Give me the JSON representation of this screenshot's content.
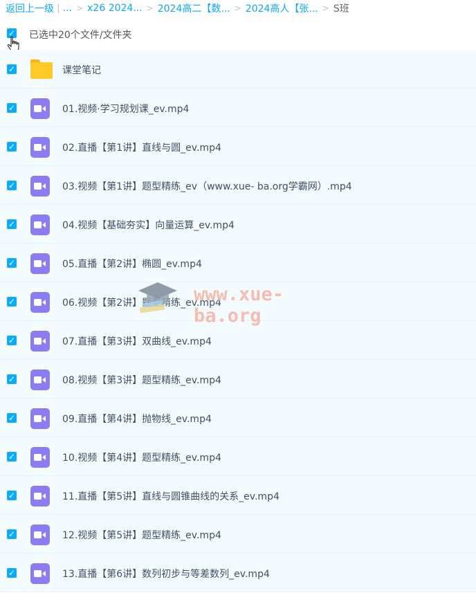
{
  "breadcrumb": {
    "back_label": "返回上一级",
    "ellipsis": "...",
    "crumbs": [
      "x26 2024...",
      "2024高二【数...",
      "2024高人【张..."
    ],
    "current": "S班"
  },
  "selection": {
    "summary": "已选中20个文件/文件夹",
    "checked": true
  },
  "files": [
    {
      "type": "folder",
      "name": "课堂笔记"
    },
    {
      "type": "video",
      "name": "01.视频·学习规划课_ev.mp4"
    },
    {
      "type": "video",
      "name": "02.直播【第1讲】直线与圆_ev.mp4"
    },
    {
      "type": "video",
      "name": "03.视频【第1讲】题型精练_ev（www.xue- ba.org学霸网）.mp4"
    },
    {
      "type": "video",
      "name": "04.视频【基础夯实】向量运算_ev.mp4"
    },
    {
      "type": "video",
      "name": "05.直播【第2讲】椭圆_ev.mp4"
    },
    {
      "type": "video",
      "name": "06.视频【第2讲】题型精练_ev.mp4"
    },
    {
      "type": "video",
      "name": "07.直播【第3讲】双曲线_ev.mp4"
    },
    {
      "type": "video",
      "name": "08.视频【第3讲】题型精练_ev.mp4"
    },
    {
      "type": "video",
      "name": "09.直播【第4讲】抛物线_ev.mp4"
    },
    {
      "type": "video",
      "name": "10.视频【第4讲】题型精练_ev.mp4"
    },
    {
      "type": "video",
      "name": "11.直播【第5讲】直线与圆锥曲线的关系_ev.mp4"
    },
    {
      "type": "video",
      "name": "12.视频【第5讲】题型精练_ev.mp4"
    },
    {
      "type": "video",
      "name": "13.直播【第6讲】数列初步与等差数列_ev.mp4"
    }
  ],
  "watermark": {
    "text": "www.xue-ba.org"
  },
  "colors": {
    "accent": "#09aaff",
    "row_bg": "#f4fbff",
    "folder": "#ffc928",
    "video": "#8c7cf0",
    "watermark": "#f6b7a8"
  },
  "icons": {
    "checkbox": "check-icon",
    "folder": "folder-icon",
    "video": "video-file-icon",
    "cursor": "hand-cursor-icon",
    "watermark_logo": "graduation-cap-icon"
  }
}
